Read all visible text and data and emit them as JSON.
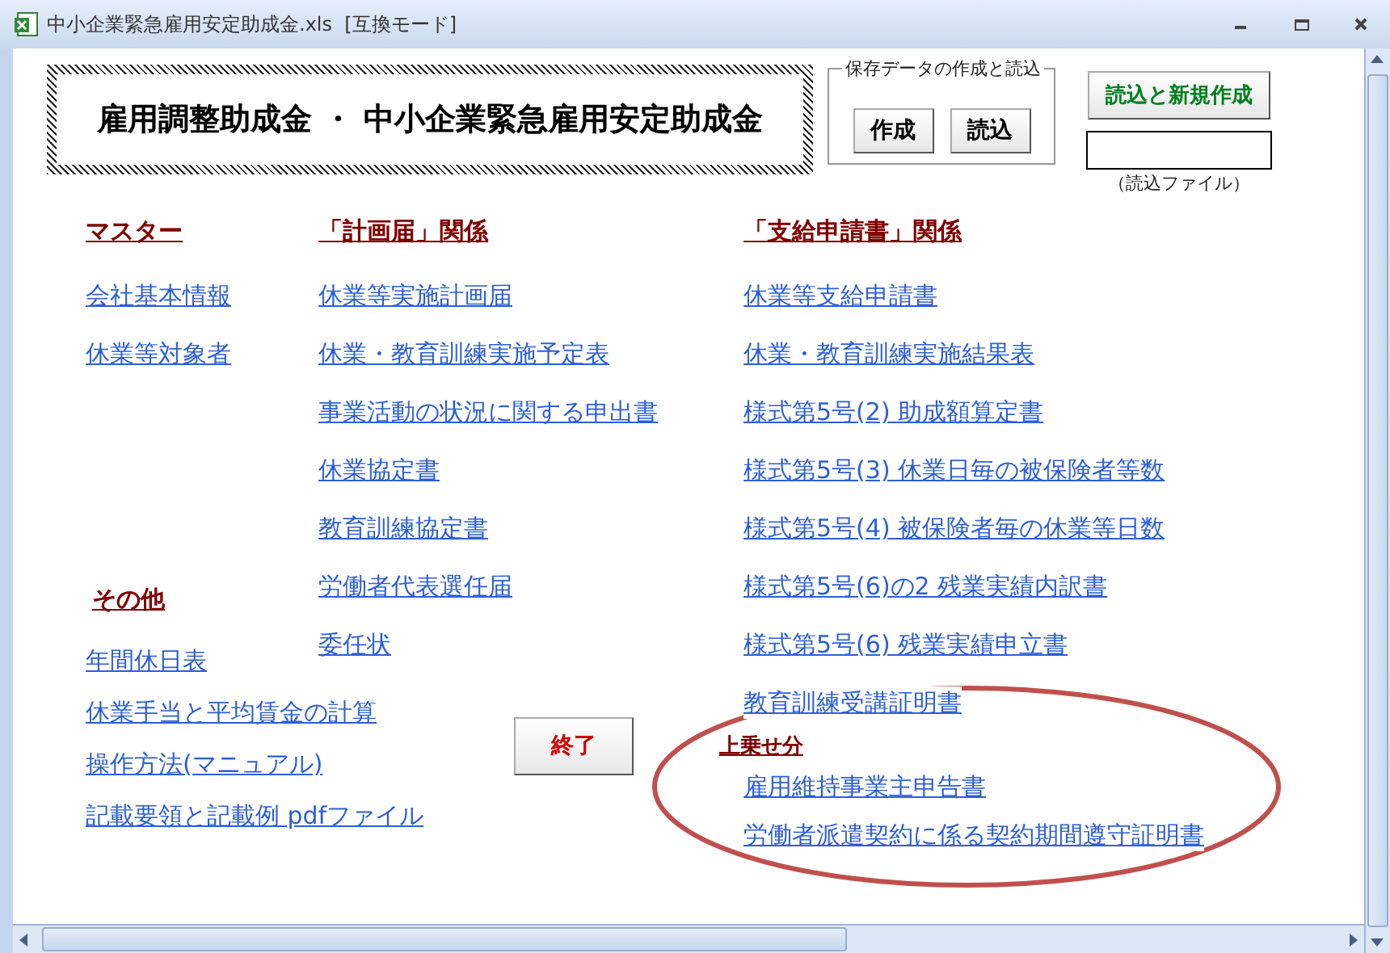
{
  "window": {
    "title": "中小企業緊急雇用安定助成金.xls  [互換モード]"
  },
  "banner": {
    "title": "雇用調整助成金 ・ 中小企業緊急雇用安定助成金"
  },
  "save_data": {
    "label": "保存データの作成と読込",
    "buttons": [
      "作成",
      "読込"
    ]
  },
  "load_new": {
    "button": "読込と新規作成",
    "file_caption": "（読込ファイル）"
  },
  "columns": [
    {
      "sections": [
        {
          "heading": "マスター",
          "links": [
            "会社基本情報",
            "休業等対象者"
          ]
        },
        {
          "heading": "その他",
          "links": [
            "年間休日表",
            "休業手当と平均賃金の計算",
            "操作方法(マニュアル)",
            "記載要領と記載例 pdfファイル"
          ]
        }
      ]
    },
    {
      "sections": [
        {
          "heading": "「計画届」関係",
          "links": [
            "休業等実施計画届",
            "休業・教育訓練実施予定表",
            "事業活動の状況に関する申出書",
            "休業協定書",
            "教育訓練協定書",
            "労働者代表選任届",
            "委任状"
          ]
        }
      ],
      "end_button": "終了"
    },
    {
      "sections": [
        {
          "heading": "「支給申請書」関係",
          "links": [
            "休業等支給申請書",
            "休業・教育訓練実施結果表",
            "様式第5号(2) 助成額算定書",
            "様式第5号(3) 休業日毎の被保険者等数",
            "様式第5号(4) 被保険者毎の休業等日数",
            "様式第5号(6)の2 残業実績内訳書",
            "様式第5号(6) 残業実績申立書",
            "教育訓練受講証明書"
          ]
        },
        {
          "heading": "上乗せ分",
          "small": true,
          "circled": true,
          "links": [
            "雇用維持事業主申告書",
            "労働者派遣契約に係る契約期間遵守証明書"
          ]
        }
      ]
    }
  ]
}
